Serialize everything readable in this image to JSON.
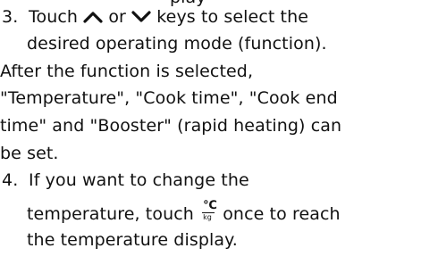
{
  "lines": {
    "l0": "play",
    "l1_num": "3.",
    "l1_a": "Touch",
    "l1_or": "or",
    "l1_b": "keys to select the",
    "l2": "desired operating mode (function).",
    "l3": "After the function is selected,",
    "l4": "\"Temperature\", \"Cook time\", \"Cook end",
    "l5": "time\" and \"Booster\" (rapid heating) can",
    "l6": "be set.",
    "l7_num": "4.",
    "l7": "If you want to change the",
    "l8_a": "temperature, touch",
    "l8_b": "once to reach",
    "l9": "the temperature display."
  },
  "icons": {
    "up": "chevron-up-icon",
    "down": "chevron-down-icon",
    "temp": "temperature-weight-icon",
    "temp_top": "℃",
    "temp_bottom": "kg"
  }
}
